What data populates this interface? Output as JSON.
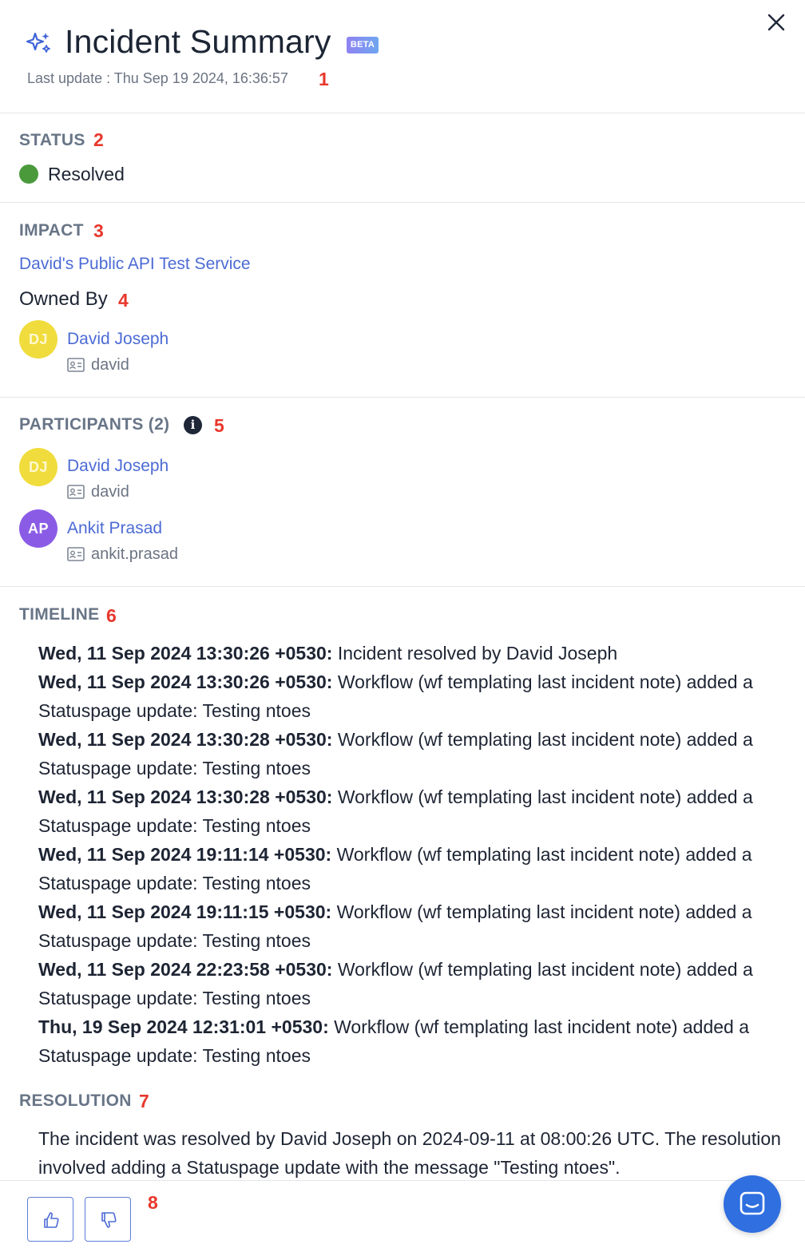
{
  "header": {
    "title": "Incident Summary",
    "badge": "BETA",
    "last_update": "Last update : Thu Sep 19 2024, 16:36:57",
    "markers": [
      "1",
      "2",
      "3",
      "4",
      "5",
      "6",
      "7",
      "8"
    ]
  },
  "status": {
    "label": "STATUS",
    "value": "Resolved",
    "color": "#4a9a3c"
  },
  "impact": {
    "label": "IMPACT",
    "service": "David's Public API Test Service",
    "owned_by_label": "Owned By",
    "owner": {
      "initials": "DJ",
      "name": "David Joseph",
      "username": "david"
    }
  },
  "participants": {
    "label": "PARTICIPANTS (2)",
    "info_glyph": "i",
    "people": [
      {
        "initials": "DJ",
        "name": "David Joseph",
        "username": "david",
        "color": "#f0dc3c"
      },
      {
        "initials": "AP",
        "name": "Ankit Prasad",
        "username": "ankit.prasad",
        "color": "#8a5ce6"
      }
    ]
  },
  "timeline": {
    "label": "TIMELINE",
    "entries": [
      {
        "time": "Wed, 11 Sep 2024 13:30:26 +0530:",
        "text": " Incident resolved by David Joseph"
      },
      {
        "time": "Wed, 11 Sep 2024 13:30:26 +0530:",
        "text": " Workflow (wf templating last incident note) added a Statuspage update: Testing ntoes"
      },
      {
        "time": "Wed, 11 Sep 2024 13:30:28 +0530:",
        "text": " Workflow (wf templating last incident note) added a Statuspage update: Testing ntoes"
      },
      {
        "time": "Wed, 11 Sep 2024 13:30:28 +0530:",
        "text": " Workflow (wf templating last incident note) added a Statuspage update: Testing ntoes"
      },
      {
        "time": "Wed, 11 Sep 2024 19:11:14 +0530:",
        "text": " Workflow (wf templating last incident note) added a Statuspage update: Testing ntoes"
      },
      {
        "time": "Wed, 11 Sep 2024 19:11:15 +0530:",
        "text": " Workflow (wf templating last incident note) added a Statuspage update: Testing ntoes"
      },
      {
        "time": "Wed, 11 Sep 2024 22:23:58 +0530:",
        "text": " Workflow (wf templating last incident note) added a Statuspage update: Testing ntoes"
      },
      {
        "time": "Thu, 19 Sep 2024 12:31:01 +0530:",
        "text": " Workflow (wf templating last incident note) added a Statuspage update: Testing ntoes"
      }
    ]
  },
  "resolution": {
    "label": "RESOLUTION",
    "text": "The incident was resolved by David Joseph on 2024-09-11 at 08:00:26 UTC. The resolution involved adding a Statuspage update with the message \"Testing ntoes\"."
  },
  "footer": {
    "thumbs_up_icon": "thumbs-up-icon",
    "thumbs_down_icon": "thumbs-down-icon",
    "chat_icon": "chat-icon"
  },
  "colors": {
    "accent": "#4c6bd4",
    "marker": "#e8372b",
    "chat_button": "#2f6fe0"
  }
}
